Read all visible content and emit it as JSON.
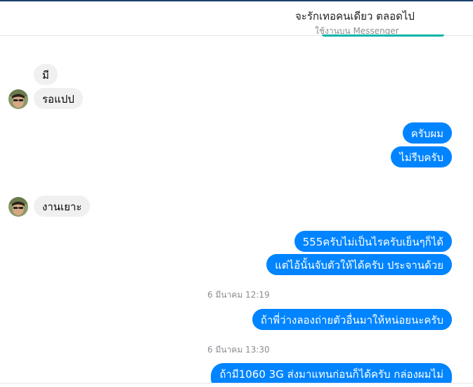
{
  "header": {
    "title": "จะรักเทอคนเดียว ตลอดไป",
    "subtitle": "ใช้งานบน Messenger",
    "accent_color": "#0ab3a9"
  },
  "colors": {
    "outgoing_bubble": "#0084ff",
    "incoming_bubble": "#f0f0f0"
  },
  "messages": {
    "m1": "มี",
    "m2": "รอแปป",
    "m3": "ครับผม",
    "m4": "ไม่รีบครับ",
    "m5": "งานเยาะ",
    "m6": "555ครับไม่เป็นไรครับเย็นๆก็ได้",
    "m7": "แต่ไอ้นั้นจับตัวให้ได้ครับ ประจานด้วย",
    "m8": "ถ้าพี่ว่างลองถ่ายตัวอื่นมาให้หน่อยนะครับ",
    "m9": "ถ้ามี1060 3G  ส่งมาแทนก่อนก็ได้ครับ  กล่องผมไม่"
  },
  "timestamps": {
    "t1": "6 มีนาคม 12:19",
    "t2": "6 มีนาคม 13:30"
  },
  "avatars": {
    "icon": "user-avatar-photo"
  }
}
